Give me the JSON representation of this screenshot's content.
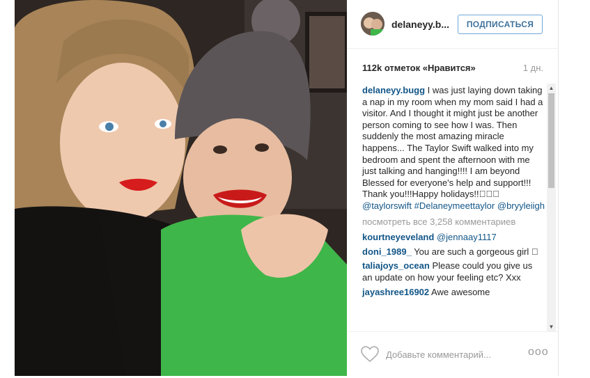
{
  "post": {
    "username": "delaneyy.b...",
    "follow_label": "ПОДПИСАТЬСЯ",
    "likes": "112k отметок «Нравится»",
    "time_ago": "1 дн."
  },
  "comments": {
    "caption": {
      "user": "delaneyy.bugg",
      "text": " I was just laying down taking a nap in my room when my mom said I had a visitor. And I thought it might just be another person coming to see how I was. Then suddenly the most amazing miracle happens... The Taylor Swift walked into my bedroom and spent the afternoon with me just talking and hanging!!!! I am beyond Blessed for everyone's help and support!!! Thank you!!!Happy holidays!!",
      "emoji": "􀀁􀀁􀀁",
      "mention1": "@taylorswift",
      "hashtag": "#Delaneymeettaylor",
      "mention2": "@bryyleiigh"
    },
    "view_all": "посмотреть все 3,258 комментариев",
    "items": [
      {
        "user": "kourtneyeveland",
        "text": "",
        "mention": "@jennaay1117"
      },
      {
        "user": "doni_1989_",
        "text": " You are such a gorgeous girl ",
        "emoji": "􀀁"
      },
      {
        "user": "taliajoys_ocean",
        "text": " Please could you give us an update on how your feeling etc? Xxx"
      },
      {
        "user": "jayashree16902",
        "text": " Awe awesome"
      }
    ]
  },
  "footer": {
    "comment_placeholder": "Добавьте комментарий...",
    "more_label": "ooo"
  },
  "icons": {
    "heart": "heart-icon",
    "more": "more-options-icon",
    "scroll_up": "scroll-up-icon",
    "scroll_down": "scroll-down-icon"
  },
  "colors": {
    "link": "#125688",
    "follow_text": "#3f729b",
    "follow_border": "#70a7d9",
    "muted": "#999999"
  }
}
